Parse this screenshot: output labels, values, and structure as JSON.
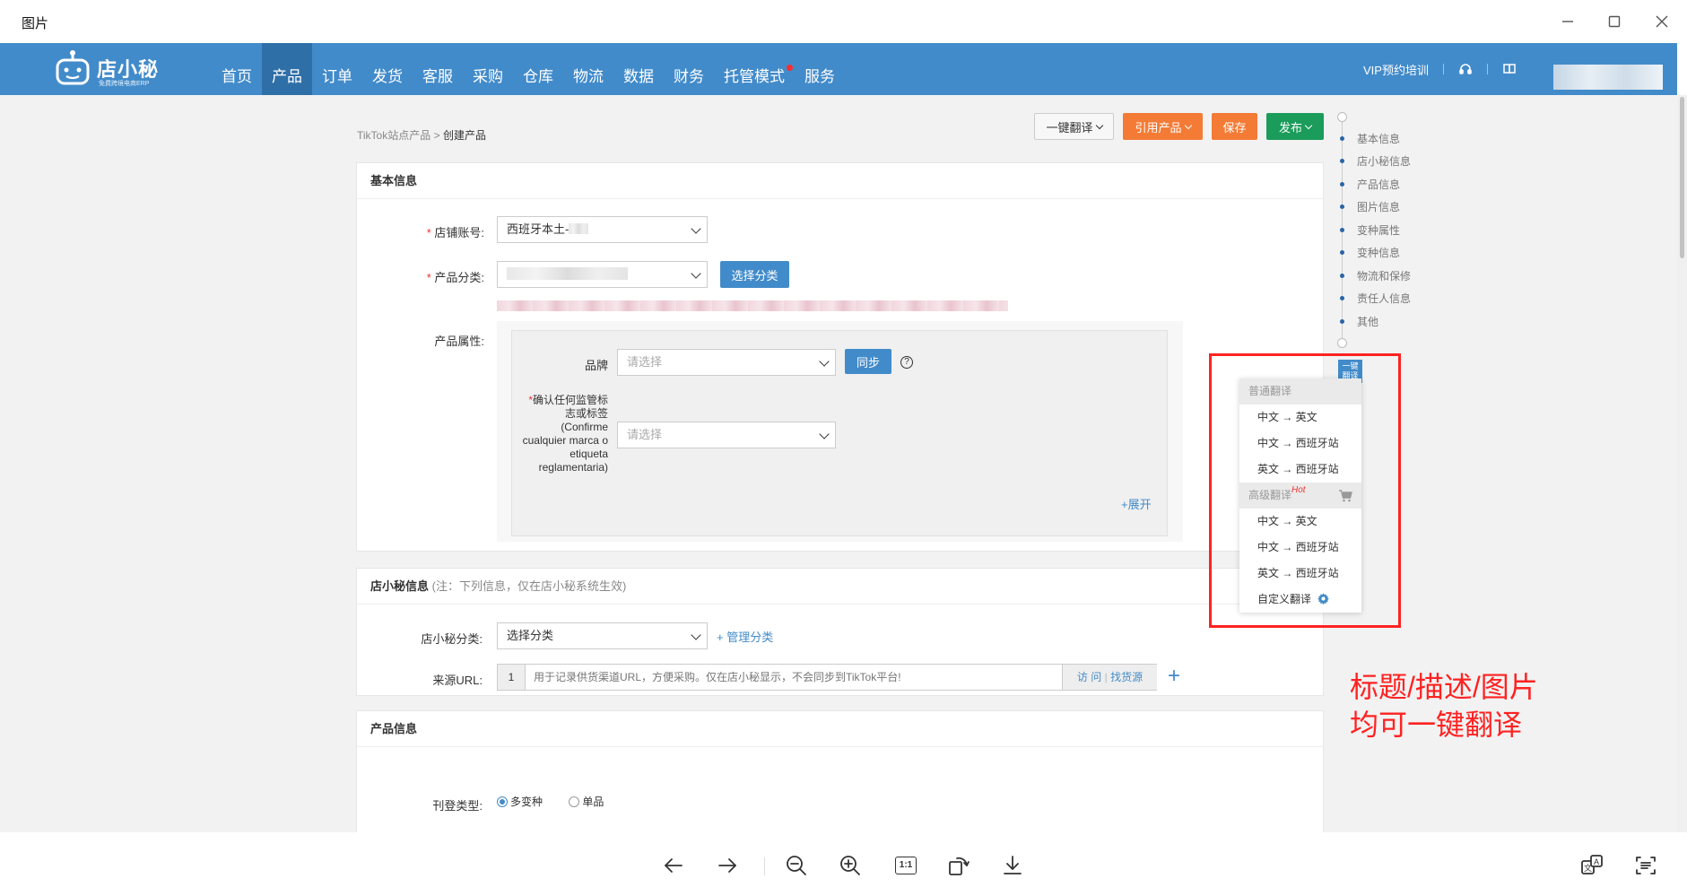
{
  "window": {
    "title": "图片"
  },
  "brand": {
    "name": "店小秘",
    "subtitle": "免费跨境电商ERP"
  },
  "nav": {
    "items": [
      "首页",
      "产品",
      "订单",
      "发货",
      "客服",
      "采购",
      "仓库",
      "物流",
      "数据",
      "财务",
      "托管模式",
      "服务"
    ],
    "active_index": 1,
    "vip": "VIP预约培训"
  },
  "breadcrumb": {
    "parent": "TikTok站点产品",
    "sep": ">",
    "current": "创建产品"
  },
  "toolbar": {
    "translate": "一键翻译",
    "import": "引用产品",
    "save": "保存",
    "publish": "发布",
    "colors": {
      "orange": "#f37b36",
      "green": "#1b9c5a"
    }
  },
  "basic": {
    "title": "基本信息",
    "shop_label": "店铺账号:",
    "shop_value": "西班牙本土-",
    "category_label": "产品分类:",
    "choose_category": "选择分类",
    "attr_label": "产品属性:",
    "brand_label": "品牌",
    "brand_placeholder": "请选择",
    "sync": "同步",
    "confirm_label": "确认任何监管标志或标签(Confirme cualquier marca o etiqueta reglamentaria)",
    "confirm_placeholder": "请选择",
    "expand": "+展开"
  },
  "dxm": {
    "title": "店小秘信息",
    "note": "(注：下列信息，仅在店小秘系统生效)",
    "cat_label": "店小秘分类:",
    "cat_value": "选择分类",
    "manage": "+ 管理分类",
    "url_label": "来源URL:",
    "url_index": "1",
    "url_placeholder": "用于记录供货渠道URL，方便采购。仅在店小秘显示，不会同步到TikTok平台!",
    "visit": "访 问",
    "find": "找货源"
  },
  "product": {
    "title": "产品信息",
    "type_label": "刊登类型:",
    "opt_multi": "多变种",
    "opt_single": "单品"
  },
  "anchors": [
    "基本信息",
    "店小秘信息",
    "产品信息",
    "图片信息",
    "变种属性",
    "变种信息",
    "物流和保修",
    "责任人信息",
    "其他"
  ],
  "translate_menu": {
    "button": "一键翻译",
    "normal_group": "普通翻译",
    "normal": [
      "中文 → 英文",
      "中文 → 西班牙站",
      "英文 → 西班牙站"
    ],
    "advanced_group": "高级翻译",
    "hot": "Hot",
    "advanced": [
      "中文 → 英文",
      "中文 → 西班牙站",
      "英文 → 西班牙站"
    ],
    "custom": "自定义翻译"
  },
  "annotation": {
    "line1": "标题/描述/图片",
    "line2": "均可一键翻译"
  },
  "icons": [
    "minimize-icon",
    "maximize-icon",
    "close-icon",
    "headset-icon",
    "book-icon",
    "cart-icon",
    "gear-icon",
    "help-icon",
    "arrow-left-icon",
    "arrow-right-icon",
    "zoom-out-icon",
    "zoom-in-icon",
    "actual-size-icon",
    "rotate-icon",
    "download-icon",
    "translate-icon",
    "ocr-icon"
  ],
  "viewer": {
    "actual_size": "1:1"
  }
}
